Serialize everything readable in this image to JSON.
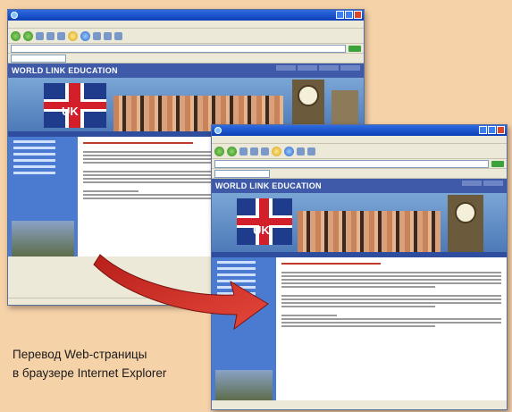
{
  "caption": {
    "line1": "Перевод Web-страницы",
    "line2": "в браузере Internet Explorer"
  },
  "site": {
    "logo_text": "WORLD LINK EDUCATION",
    "banner_text": "UK"
  },
  "colors": {
    "background": "#f6d2a9",
    "titlebar": "#0b3fb8",
    "site_header": "#3e5aa8",
    "arrow": "#d8322a"
  }
}
